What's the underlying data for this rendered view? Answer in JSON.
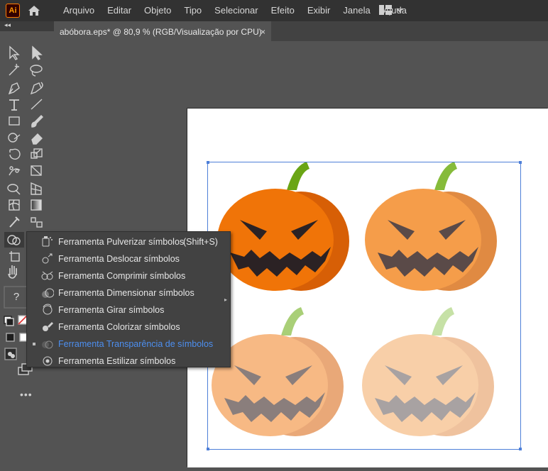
{
  "app": {
    "logo_text": "Ai",
    "brand_color": "#ff9a00"
  },
  "menubar": {
    "items": [
      "Arquivo",
      "Editar",
      "Objeto",
      "Tipo",
      "Selecionar",
      "Efeito",
      "Exibir",
      "Janela",
      "Ajuda"
    ],
    "home_icon": "home-icon",
    "workspace_icon": "workspace-switcher-icon"
  },
  "document_tab": {
    "title": "abóbora.eps* @ 80,9 % (RGB/Visualização por CPU)",
    "close": "×"
  },
  "toolbar_collapse": "◂◂",
  "toolbox_more": "•••",
  "toolbox_tools": [
    "selection-tool",
    "direct-selection-tool",
    "magic-wand-tool",
    "lasso-tool",
    "pen-tool",
    "curvature-tool",
    "type-tool",
    "line-segment-tool",
    "rectangle-tool",
    "paintbrush-tool",
    "shaper-tool",
    "eraser-tool",
    "rotate-tool",
    "scale-tool",
    "puppet-warp-tool",
    "free-transform-tool",
    "shape-builder-tool",
    "perspective-grid-tool",
    "mesh-tool",
    "gradient-tool",
    "eyedropper-tool",
    "blend-tool",
    "symbol-sprayer-tool",
    "artboard-tool",
    "hand-tool",
    "help-question"
  ],
  "help_label": "?",
  "flyout": {
    "items": [
      {
        "label": "Ferramenta Pulverizar símbolos",
        "shortcut": "(Shift+S)",
        "active": false,
        "icon": "symbol-sprayer-icon"
      },
      {
        "label": "Ferramenta Deslocar símbolos",
        "shortcut": "",
        "active": false,
        "icon": "symbol-shifter-icon"
      },
      {
        "label": "Ferramenta Comprimir símbolos",
        "shortcut": "",
        "active": false,
        "icon": "symbol-scruncher-icon"
      },
      {
        "label": "Ferramenta Dimensionar símbolos",
        "shortcut": "",
        "active": false,
        "icon": "symbol-sizer-icon"
      },
      {
        "label": "Ferramenta Girar símbolos",
        "shortcut": "",
        "active": false,
        "icon": "symbol-spinner-icon"
      },
      {
        "label": "Ferramenta Colorizar símbolos",
        "shortcut": "",
        "active": false,
        "icon": "symbol-stainer-icon"
      },
      {
        "label": "Ferramenta Transparência de símbolos",
        "shortcut": "",
        "active": true,
        "icon": "symbol-screener-icon"
      },
      {
        "label": "Ferramenta Estilizar símbolos",
        "shortcut": "",
        "active": false,
        "icon": "symbol-styler-icon"
      }
    ]
  },
  "artwork": {
    "pumpkins": [
      {
        "body": "#f07408",
        "side": "#d75f06",
        "stem": "#6aa515",
        "face": "#2b2224",
        "opacity": 1
      },
      {
        "body": "#f59d4a",
        "side": "#e08a42",
        "stem": "#86bb3a",
        "face": "#5a4a48",
        "opacity": 1
      },
      {
        "body": "#f7b984",
        "side": "#e9a878",
        "stem": "#a9cf77",
        "face": "#8a7e7c",
        "opacity": 1
      },
      {
        "body": "#f8cfa8",
        "side": "#efc29e",
        "stem": "#c6e1a6",
        "face": "#a8a2a2",
        "opacity": 1
      }
    ],
    "selection_color": "#4d7fd8"
  }
}
